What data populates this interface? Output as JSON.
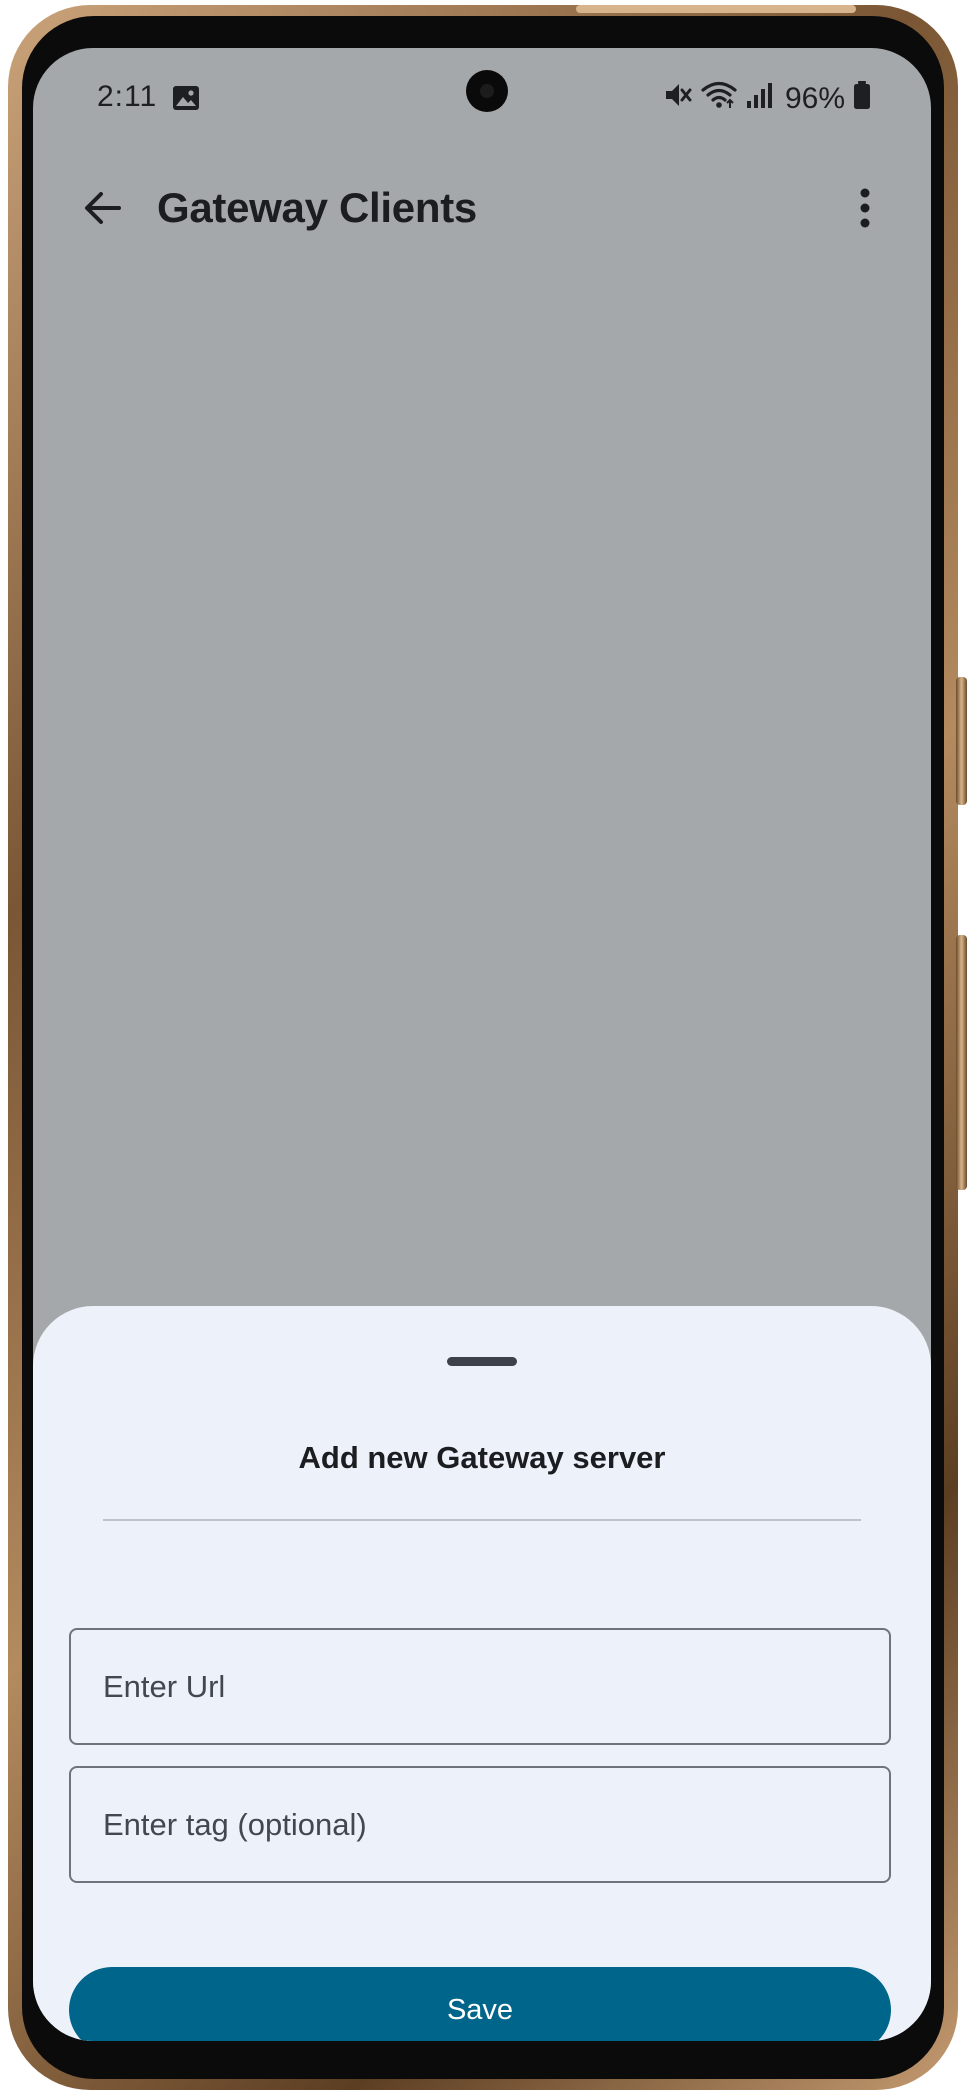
{
  "status_bar": {
    "time": "2:11",
    "battery_percent": "96%",
    "icons": [
      "gallery-icon",
      "mute-icon",
      "wifi-icon",
      "signal-icon",
      "battery-icon"
    ]
  },
  "app_bar": {
    "title": "Gateway Clients",
    "back_icon": "arrow-back-icon",
    "menu_icon": "more-vert-icon"
  },
  "sheet": {
    "title": "Add new Gateway server",
    "url_field": {
      "placeholder": "Enter Url",
      "value": ""
    },
    "tag_field": {
      "placeholder": "Enter tag (optional)",
      "value": ""
    },
    "save_label": "Save"
  },
  "colors": {
    "scrim": "#a5a8ab",
    "sheet_background": "#edf2fa",
    "primary": "#00658b",
    "on_primary": "#ffffff",
    "text": "#1b1d20",
    "outline": "#6f747b"
  }
}
